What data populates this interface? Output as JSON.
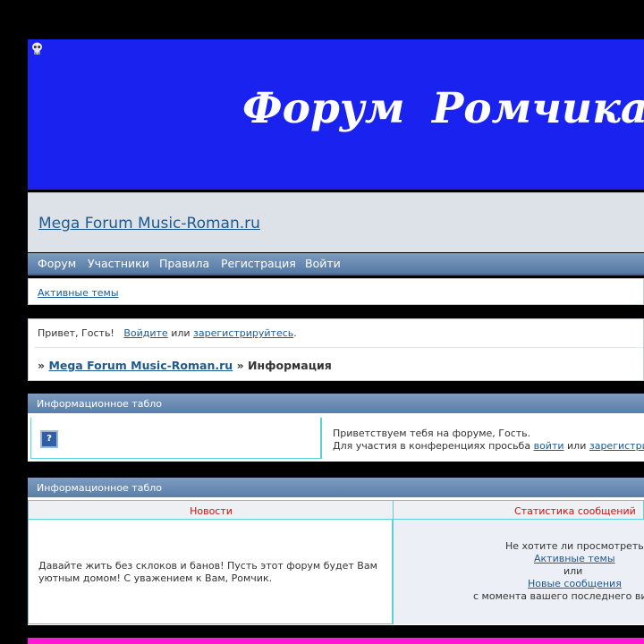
{
  "banner": {
    "title": "Форум  Ромчика  п"
  },
  "header": {
    "site_link": "Mega Forum Music-Roman.ru"
  },
  "navbar": {
    "items": [
      "Форум",
      "Участники",
      "Правила",
      "Регистрация",
      "Войти"
    ]
  },
  "subnav": {
    "active_topics": "Активные темы"
  },
  "greeting": {
    "hello": "Привет, Гость!",
    "login_link": "Войдите",
    "or": "или",
    "register_link": "зарегистрируйтесь",
    "end": "."
  },
  "breadcrumbs": {
    "sep": "»",
    "root": "Mega Forum Music-Roman.ru",
    "current": "Информация"
  },
  "info1": {
    "title": "Информационное табло",
    "welcome": "Приветствуем тебя на форуме, Гость.",
    "participate": "Для участия в конференциях просьба",
    "login_link": "войти",
    "or": "или",
    "register_link": "зарегистри"
  },
  "info2": {
    "title": "Информационное табло",
    "col_news": "Новости",
    "col_stats": "Статистика сообщений",
    "news_text": "Давайте жить без склоков и банов! Пусть этот форум будет Вам уютным домом! С уважением к Вам, Ромчик.",
    "stats": {
      "question": "Не хотите ли просмотреть",
      "active_topics": "Активные темы",
      "or": "или",
      "new_posts": "Новые сообщения",
      "since": "с момента вашего последнего ви"
    }
  },
  "colors": {
    "banner": "#1a22f0",
    "link": "#1c5a8f",
    "bottom_strip": "#ff16d8"
  }
}
